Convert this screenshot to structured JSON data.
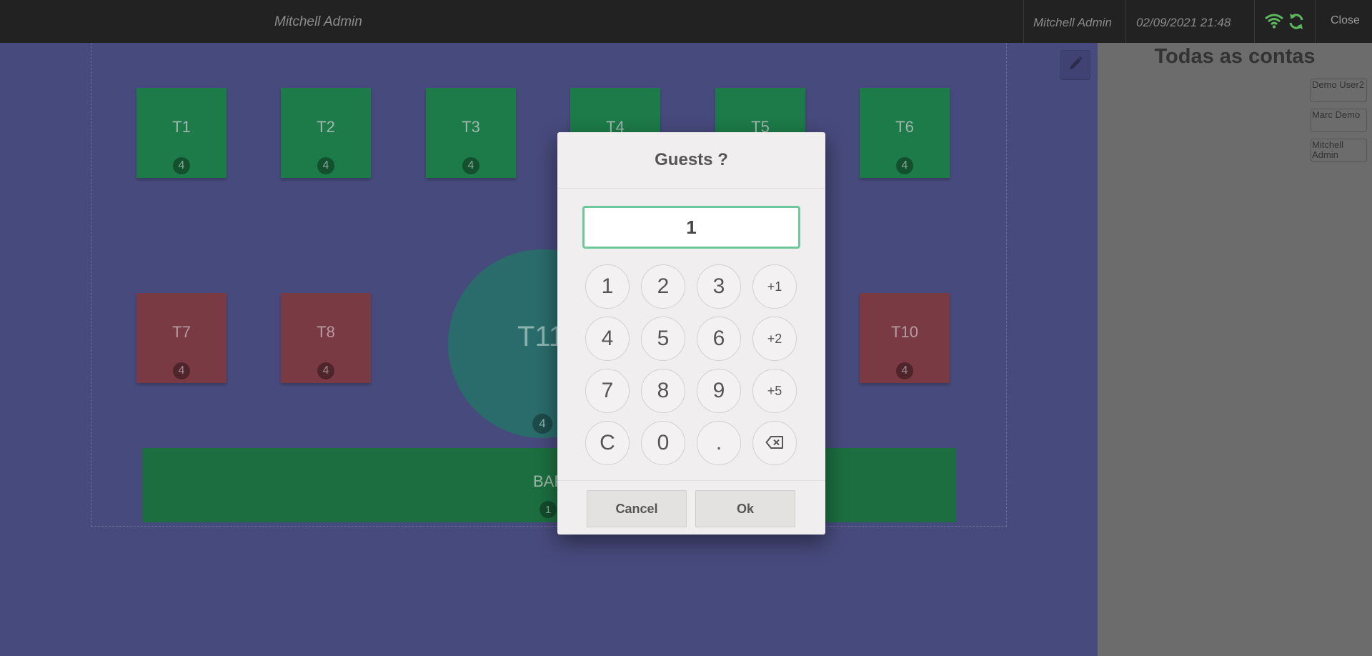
{
  "topbar": {
    "cashier": "Mitchell Admin",
    "user": "Mitchell Admin",
    "datetime": "02/09/2021 21:48",
    "close_label": "Close",
    "icons": [
      "wifi-icon",
      "sync-icon"
    ],
    "status_color": "#5cb85c"
  },
  "floor": {
    "background_color": "#474a7c",
    "edit_icon": "pencil-icon",
    "tables": [
      {
        "name": "T1",
        "seats": "4",
        "status": "green"
      },
      {
        "name": "T2",
        "seats": "4",
        "status": "green"
      },
      {
        "name": "T3",
        "seats": "4",
        "status": "green"
      },
      {
        "name": "T4",
        "seats": "",
        "status": "green"
      },
      {
        "name": "T5",
        "seats": "",
        "status": "green"
      },
      {
        "name": "T6",
        "seats": "4",
        "status": "green"
      },
      {
        "name": "T7",
        "seats": "4",
        "status": "red"
      },
      {
        "name": "T8",
        "seats": "4",
        "status": "red"
      },
      {
        "name": "T10",
        "seats": "4",
        "status": "red"
      }
    ],
    "round_table": {
      "name": "T11",
      "seats": "4"
    },
    "bar": {
      "name": "BAR",
      "seats": "1"
    }
  },
  "right_panel": {
    "title": "Todas as contas",
    "items": [
      "Demo User2",
      "Marc Demo",
      "Mitchell Admin"
    ]
  },
  "modal": {
    "title": "Guests ?",
    "input_value": "1",
    "keys": [
      "1",
      "2",
      "3",
      "+1",
      "4",
      "5",
      "6",
      "+2",
      "7",
      "8",
      "9",
      "+5",
      "C",
      "0",
      ".",
      "⌫"
    ],
    "cancel_label": "Cancel",
    "ok_label": "Ok",
    "input_border_color": "#6ec89b"
  }
}
